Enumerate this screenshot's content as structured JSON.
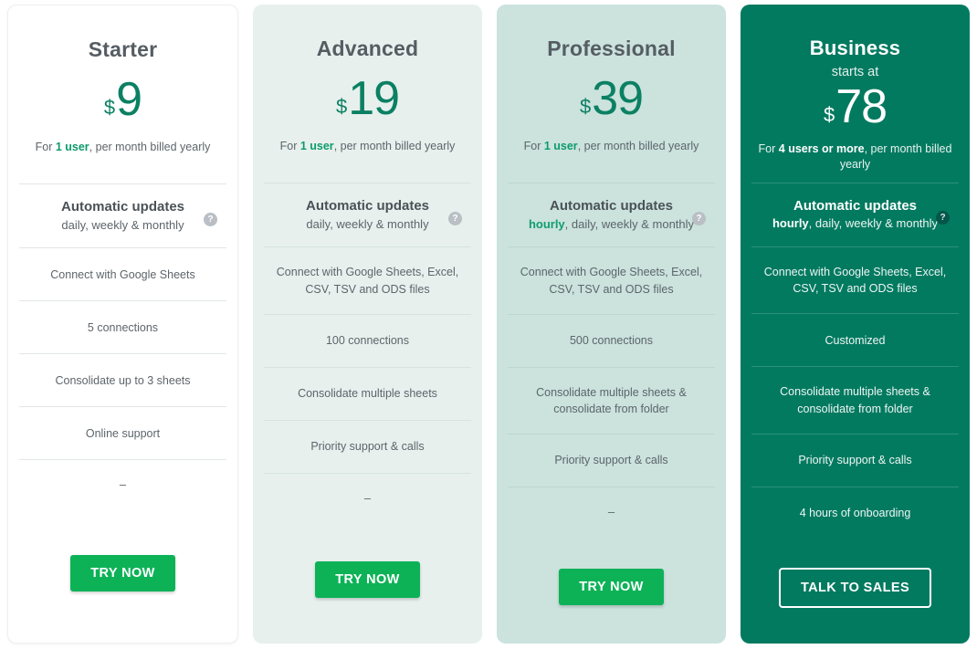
{
  "theme": {
    "price_green": "#0c8063",
    "cta_green": "#0db257",
    "business_bg": "#027a60",
    "advanced_bg": "#e7f0ed",
    "professional_bg": "#cbe2dd",
    "starter_bg": "#ffffff"
  },
  "plans": [
    {
      "name": "Starter",
      "starts_at": "",
      "currency": "$",
      "amount": "9",
      "note_prefix": "For ",
      "note_highlight": "1 user",
      "note_suffix": ", per month billed yearly",
      "updates": {
        "title": "Automatic updates",
        "sub_highlight": "",
        "sub_text": "daily, weekly & monthly",
        "help": "?"
      },
      "features": [
        "Connect with Google Sheets",
        "5 connections",
        "Consolidate up to 3 sheets",
        "Online support",
        "–"
      ],
      "cta": "TRY NOW",
      "cta_style": "solid"
    },
    {
      "name": "Advanced",
      "starts_at": "",
      "currency": "$",
      "amount": "19",
      "note_prefix": "For ",
      "note_highlight": "1 user",
      "note_suffix": ", per month billed yearly",
      "updates": {
        "title": "Automatic updates",
        "sub_highlight": "",
        "sub_text": "daily, weekly & monthly",
        "help": "?"
      },
      "features": [
        "Connect with Google Sheets, Excel, CSV, TSV and ODS files",
        "100 connections",
        "Consolidate multiple sheets",
        "Priority support & calls",
        "–"
      ],
      "cta": "TRY NOW",
      "cta_style": "solid"
    },
    {
      "name": "Professional",
      "starts_at": "",
      "currency": "$",
      "amount": "39",
      "note_prefix": "For ",
      "note_highlight": "1 user",
      "note_suffix": ", per month billed yearly",
      "updates": {
        "title": "Automatic updates",
        "sub_highlight": "hourly",
        "sub_text": ", daily, weekly & monthly",
        "help": "?"
      },
      "features": [
        "Connect with Google Sheets, Excel, CSV, TSV and ODS files",
        "500 connections",
        "Consolidate multiple sheets & consolidate from folder",
        "Priority support & calls",
        "–"
      ],
      "cta": "TRY NOW",
      "cta_style": "solid"
    },
    {
      "name": "Business",
      "starts_at": "starts at",
      "currency": "$",
      "amount": "78",
      "note_prefix": "For ",
      "note_highlight": "4 users or more",
      "note_suffix": ", per month billed yearly",
      "updates": {
        "title": "Automatic updates",
        "sub_highlight": "hourly",
        "sub_text": ", daily, weekly & monthly",
        "help": "?"
      },
      "features": [
        "Connect with Google Sheets, Excel, CSV, TSV and ODS files",
        "Customized",
        "Consolidate multiple sheets & consolidate from folder",
        "Priority support & calls",
        "4 hours of onboarding"
      ],
      "cta": "TALK TO SALES",
      "cta_style": "outline"
    }
  ]
}
